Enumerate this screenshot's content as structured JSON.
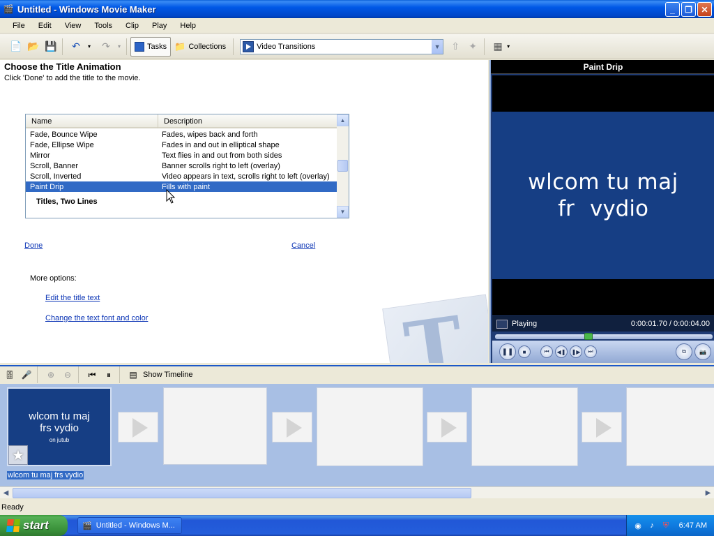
{
  "window": {
    "title": "Untitled - Windows Movie Maker"
  },
  "menu": [
    "File",
    "Edit",
    "View",
    "Tools",
    "Clip",
    "Play",
    "Help"
  ],
  "toolbar": {
    "tasks_label": "Tasks",
    "collections_label": "Collections",
    "collection_selected": "Video Transitions"
  },
  "task": {
    "heading": "Choose the Title Animation",
    "subheading": "Click 'Done' to add the title to the movie.",
    "columns": {
      "name": "Name",
      "description": "Description"
    },
    "rows": [
      {
        "name": "Fade, Bounce Wipe",
        "description": "Fades, wipes back and forth"
      },
      {
        "name": "Fade, Ellipse Wipe",
        "description": "Fades in and out in elliptical shape"
      },
      {
        "name": "Mirror",
        "description": "Text flies in and out from both sides"
      },
      {
        "name": "Scroll, Banner",
        "description": "Banner scrolls right to left (overlay)"
      },
      {
        "name": "Scroll, Inverted",
        "description": "Video appears in text, scrolls right to left (overlay)"
      },
      {
        "name": "Paint Drip",
        "description": "Fills with paint"
      }
    ],
    "selected_row": "Paint Drip",
    "group_label": "Titles, Two Lines",
    "done_label": "Done",
    "cancel_label": "Cancel",
    "more_options_label": "More options:",
    "edit_text_link": "Edit the title text",
    "font_color_link": "Change the text font and color"
  },
  "monitor": {
    "title": "Paint Drip",
    "video_line1": "wlcom tu maj",
    "video_line2": "fr   vydio",
    "status": "Playing",
    "time": "0:00:01.70 / 0:00:04.00"
  },
  "storyboard": {
    "show_timeline_label": "Show Timeline",
    "clip_line1": "wlcom tu maj",
    "clip_line2": "frs vydio",
    "clip_line3": "on jutub",
    "clip_caption": "wlcom tu maj frs vydio"
  },
  "status": {
    "text": "Ready"
  },
  "taskbar": {
    "start_label": "start",
    "task_item": "Untitled - Windows M...",
    "clock": "6:47 AM"
  },
  "colors": {
    "selection": "#316ac5",
    "title_blue": "#163e84",
    "link": "#0d36b6"
  }
}
